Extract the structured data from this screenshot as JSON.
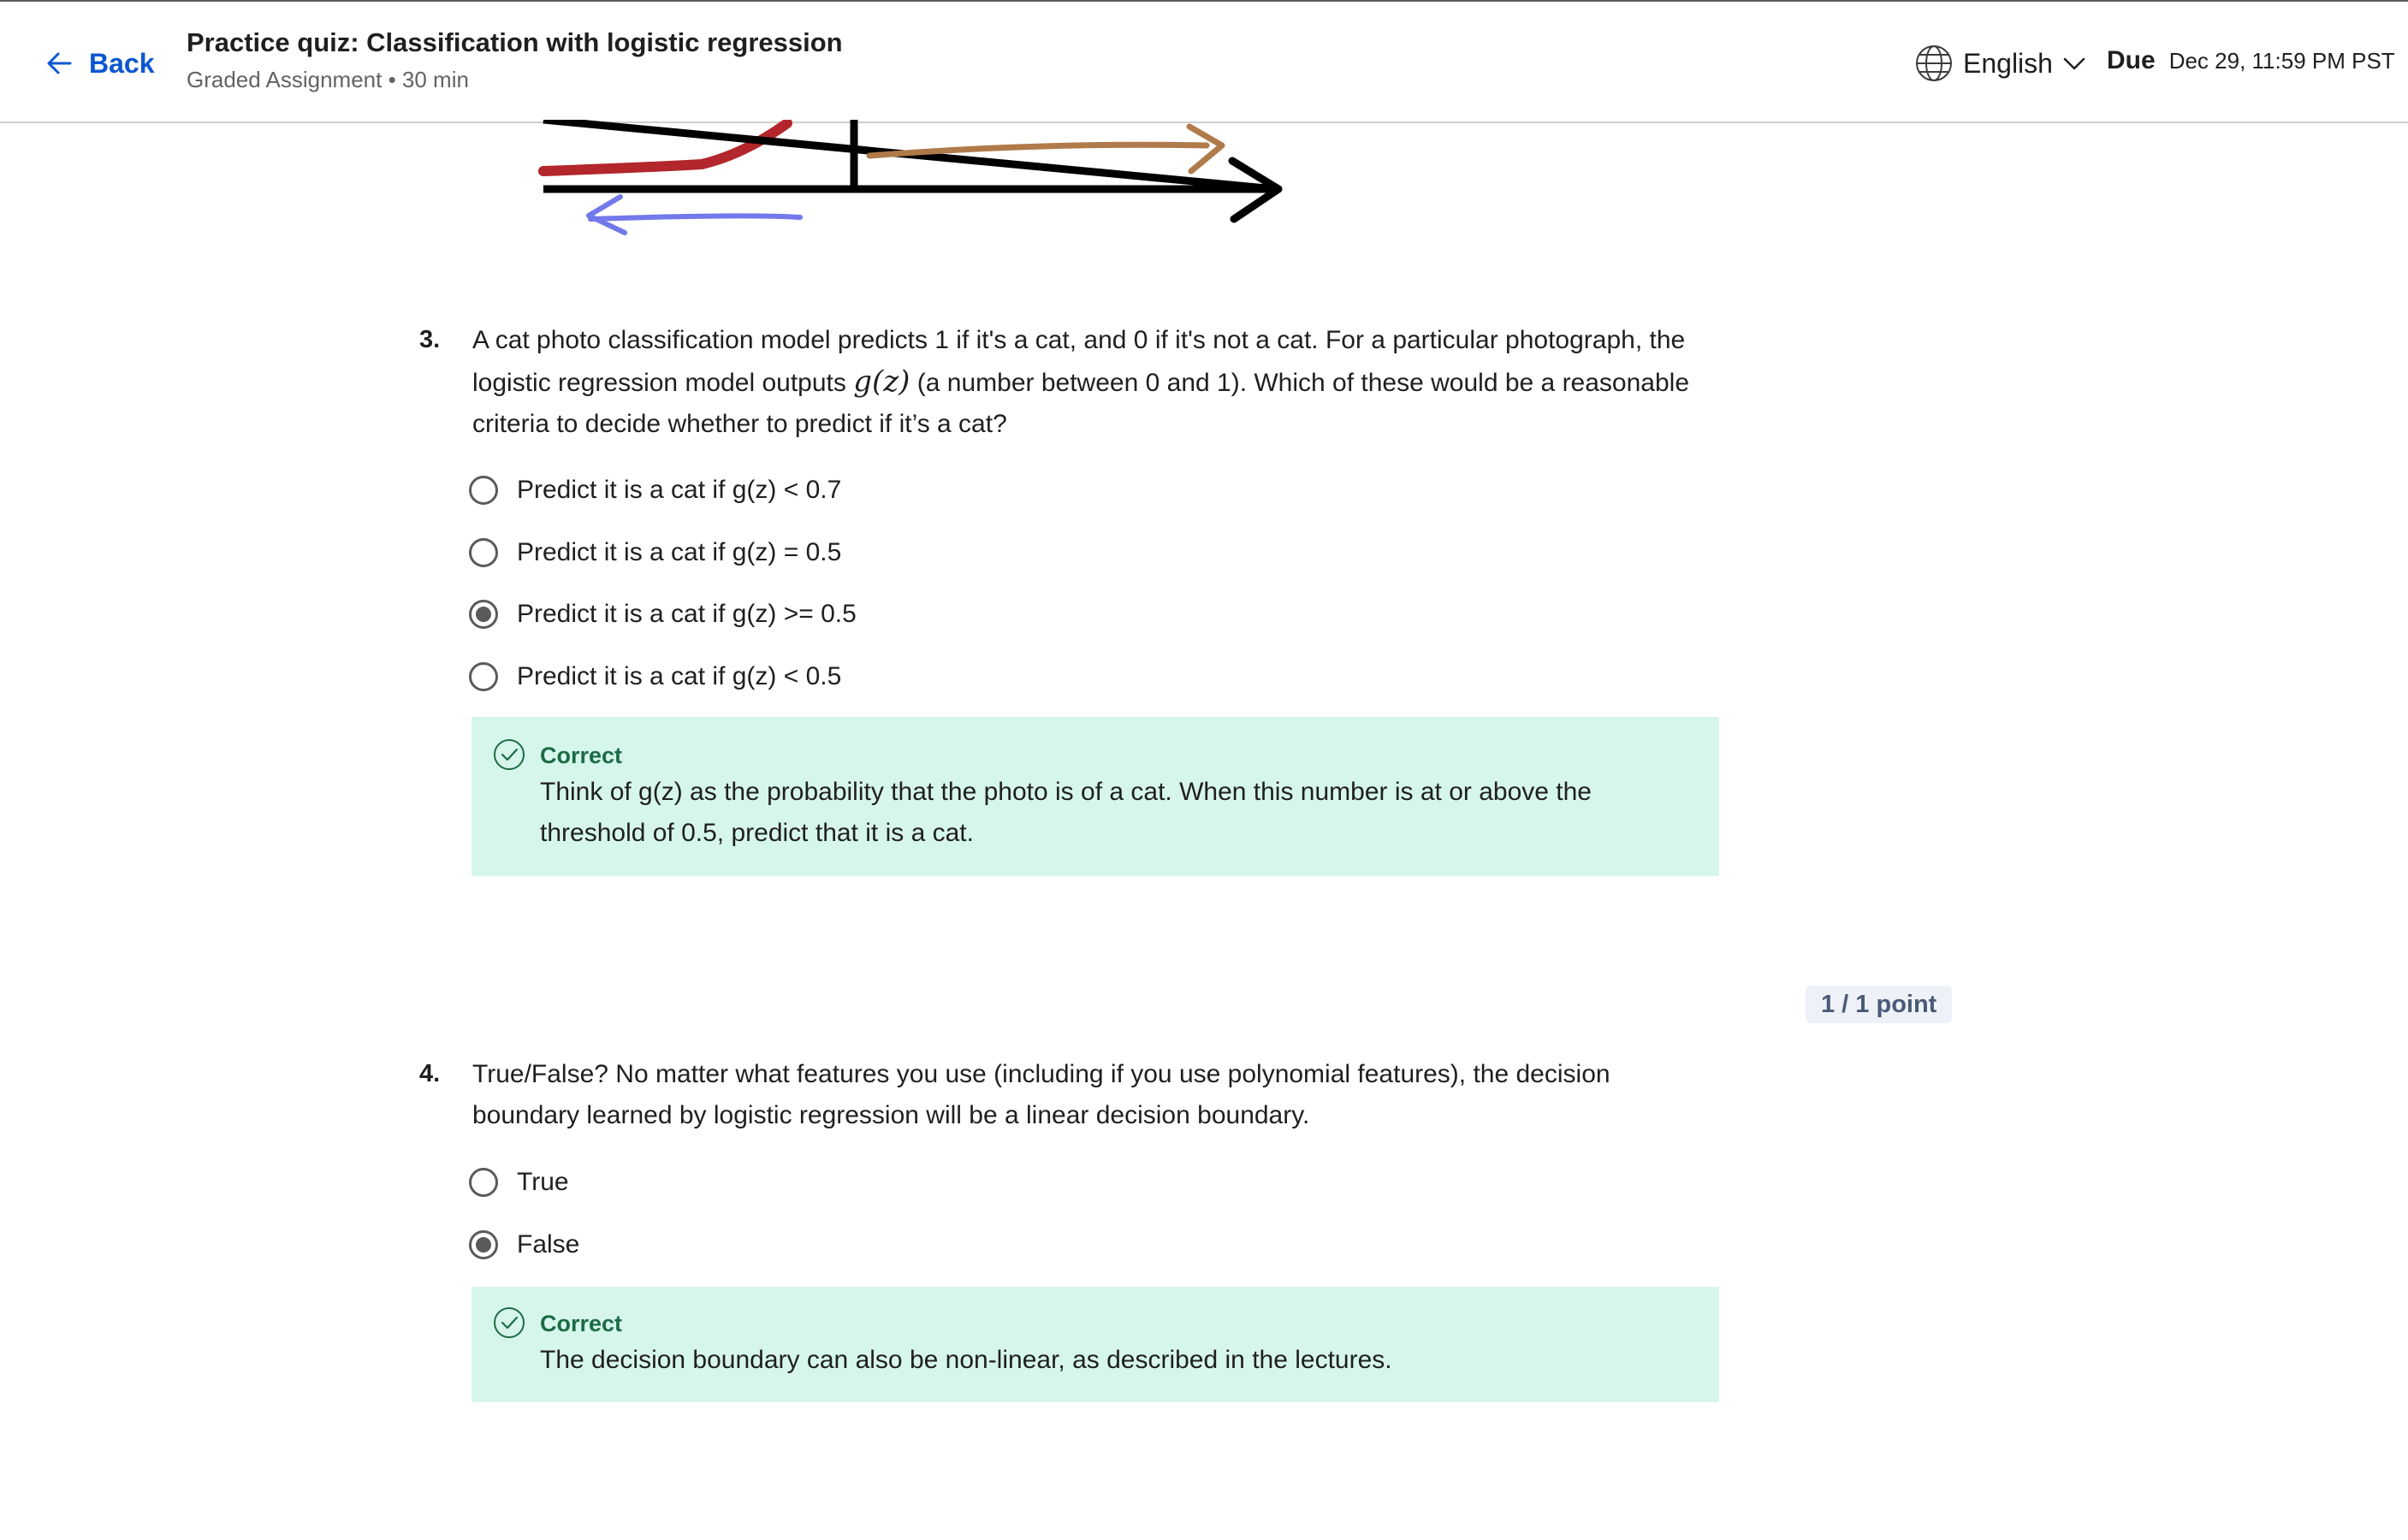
{
  "header": {
    "back_label": "Back",
    "title": "Practice quiz: Classification with logistic regression",
    "subtitle": "Graded Assignment • 30 min",
    "language": "English",
    "due_label": "Due",
    "due_date": "Dec 29, 11:59 PM PST"
  },
  "questions": [
    {
      "number": "3.",
      "text_before_math": "A cat photo classification model predicts 1 if it's a cat, and 0 if it's not a cat. For a particular photograph, the logistic regression model outputs ",
      "math": "g(z)",
      "text_after_math": " (a number between 0 and 1). Which of these would be a reasonable criteria to decide whether to predict if it’s a cat?",
      "options": [
        {
          "label": "Predict it is a cat if g(z) < 0.7",
          "selected": false
        },
        {
          "label": "Predict it is a cat if g(z) = 0.5",
          "selected": false
        },
        {
          "label": "Predict it is a cat if g(z) >= 0.5",
          "selected": true
        },
        {
          "label": "Predict it is a cat if g(z) < 0.5",
          "selected": false
        }
      ],
      "feedback": {
        "status": "Correct",
        "text": "Think of g(z) as the probability that the photo is of a cat. When this number is at or above the threshold of 0.5, predict that it is a cat."
      }
    },
    {
      "number": "4.",
      "points": "1 / 1 point",
      "text": "True/False? No matter what features you use (including if you use polynomial features), the decision boundary learned by logistic regression will be a linear decision boundary.",
      "options": [
        {
          "label": "True",
          "selected": false
        },
        {
          "label": "False",
          "selected": true
        }
      ],
      "feedback": {
        "status": "Correct",
        "text": "The decision boundary can also be non-linear, as described in the lectures."
      }
    }
  ],
  "colors": {
    "link": "#0b57d0",
    "feedback_bg": "#d6f6ec",
    "feedback_status": "#1d6b45",
    "diagram_red": "#b3262b",
    "diagram_brown": "#b07a4a",
    "diagram_blue": "#7378ea"
  },
  "icons": [
    "back-arrow-icon",
    "globe-icon",
    "chevron-down-icon",
    "check-circle-icon"
  ]
}
